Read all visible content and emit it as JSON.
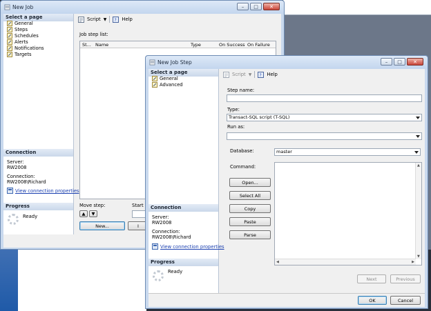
{
  "back_window": {
    "title": "New Job",
    "left": {
      "select_page_header": "Select a page",
      "pages": [
        {
          "label": "General",
          "icon": "wrench-page-icon"
        },
        {
          "label": "Steps",
          "icon": "wrench-page-icon"
        },
        {
          "label": "Schedules",
          "icon": "wrench-page-icon"
        },
        {
          "label": "Alerts",
          "icon": "wrench-page-icon"
        },
        {
          "label": "Notifications",
          "icon": "wrench-page-icon"
        },
        {
          "label": "Targets",
          "icon": "wrench-page-icon"
        }
      ],
      "connection_header": "Connection",
      "server_label": "Server:",
      "server_value": "RW2008",
      "connection_label": "Connection:",
      "connection_value": "RW2008\\Richard",
      "view_link": "View connection properties",
      "progress_header": "Progress",
      "progress_status": "Ready"
    },
    "toolbar": {
      "script": "Script",
      "help": "Help"
    },
    "job_step_list_label": "Job step list:",
    "columns": [
      "St...",
      "Name",
      "Type",
      "On Success",
      "On Failure"
    ],
    "move_step_label": "Move step:",
    "start_step_label": "Start st",
    "new_button": "New...",
    "insert_button": "I"
  },
  "front_window": {
    "title": "New Job Step",
    "left": {
      "select_page_header": "Select a page",
      "pages": [
        {
          "label": "General",
          "icon": "wrench-page-icon"
        },
        {
          "label": "Advanced",
          "icon": "wrench-page-icon"
        }
      ],
      "connection_header": "Connection",
      "server_label": "Server:",
      "server_value": "RW2008",
      "connection_label": "Connection:",
      "connection_value": "RW2008\\Richard",
      "view_link": "View connection properties",
      "progress_header": "Progress",
      "progress_status": "Ready"
    },
    "toolbar": {
      "script": "Script",
      "help": "Help"
    },
    "step_name_label": "Step name:",
    "step_name_value": "",
    "type_label": "Type:",
    "type_value": "Transact-SQL script (T-SQL)",
    "run_as_label": "Run as:",
    "run_as_value": "",
    "database_label": "Database:",
    "database_value": "master",
    "command_label": "Command:",
    "command_buttons": [
      "Open...",
      "Select All",
      "Copy",
      "Paste",
      "Parse"
    ],
    "next_button": "Next",
    "previous_button": "Previous",
    "ok_button": "OK",
    "cancel_button": "Cancel"
  }
}
